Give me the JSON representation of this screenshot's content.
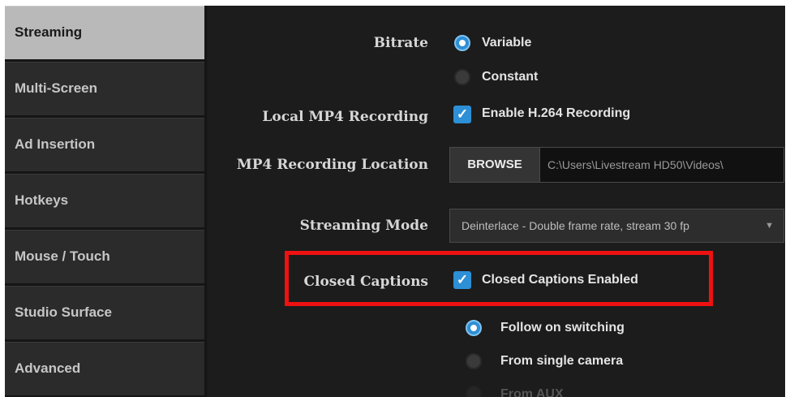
{
  "sidebar": {
    "items": [
      {
        "label": "Streaming",
        "active": true
      },
      {
        "label": "Multi-Screen",
        "active": false
      },
      {
        "label": "Ad Insertion",
        "active": false
      },
      {
        "label": "Hotkeys",
        "active": false
      },
      {
        "label": "Mouse / Touch",
        "active": false
      },
      {
        "label": "Studio Surface",
        "active": false
      },
      {
        "label": "Advanced",
        "active": false
      }
    ]
  },
  "settings": {
    "bitrate": {
      "label": "Bitrate",
      "options": [
        {
          "label": "Variable",
          "selected": true
        },
        {
          "label": "Constant",
          "selected": false
        }
      ]
    },
    "local_mp4": {
      "label": "Local MP4 Recording",
      "checkbox_label": "Enable H.264 Recording",
      "checked": true
    },
    "mp4_location": {
      "label": "MP4 Recording Location",
      "button_label": "BROWSE",
      "path": "C:\\Users\\Livestream HD50\\Videos\\"
    },
    "streaming_mode": {
      "label": "Streaming Mode",
      "value": "Deinterlace - Double frame rate, stream 30 fp"
    },
    "closed_captions": {
      "label": "Closed Captions",
      "checkbox_label": "Closed Captions Enabled",
      "checked": true,
      "options": [
        {
          "label": "Follow on switching",
          "selected": true
        },
        {
          "label": "From single camera",
          "selected": false
        },
        {
          "label": "From AUX",
          "selected": false
        }
      ]
    }
  },
  "colors": {
    "accent": "#2d8fd6",
    "highlight_border": "#ee1111",
    "sidebar_active_bg": "#b9b9b9",
    "background": "#1c1c1c"
  }
}
